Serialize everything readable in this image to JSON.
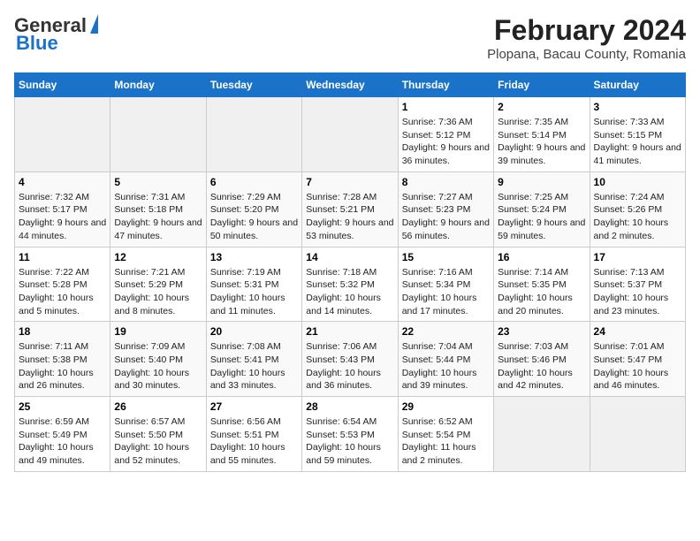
{
  "logo": {
    "line1": "General",
    "line2": "Blue"
  },
  "title": "February 2024",
  "subtitle": "Plopana, Bacau County, Romania",
  "weekdays": [
    "Sunday",
    "Monday",
    "Tuesday",
    "Wednesday",
    "Thursday",
    "Friday",
    "Saturday"
  ],
  "weeks": [
    [
      {
        "day": "",
        "info": ""
      },
      {
        "day": "",
        "info": ""
      },
      {
        "day": "",
        "info": ""
      },
      {
        "day": "",
        "info": ""
      },
      {
        "day": "1",
        "info": "Sunrise: 7:36 AM\nSunset: 5:12 PM\nDaylight: 9 hours and 36 minutes."
      },
      {
        "day": "2",
        "info": "Sunrise: 7:35 AM\nSunset: 5:14 PM\nDaylight: 9 hours and 39 minutes."
      },
      {
        "day": "3",
        "info": "Sunrise: 7:33 AM\nSunset: 5:15 PM\nDaylight: 9 hours and 41 minutes."
      }
    ],
    [
      {
        "day": "4",
        "info": "Sunrise: 7:32 AM\nSunset: 5:17 PM\nDaylight: 9 hours and 44 minutes."
      },
      {
        "day": "5",
        "info": "Sunrise: 7:31 AM\nSunset: 5:18 PM\nDaylight: 9 hours and 47 minutes."
      },
      {
        "day": "6",
        "info": "Sunrise: 7:29 AM\nSunset: 5:20 PM\nDaylight: 9 hours and 50 minutes."
      },
      {
        "day": "7",
        "info": "Sunrise: 7:28 AM\nSunset: 5:21 PM\nDaylight: 9 hours and 53 minutes."
      },
      {
        "day": "8",
        "info": "Sunrise: 7:27 AM\nSunset: 5:23 PM\nDaylight: 9 hours and 56 minutes."
      },
      {
        "day": "9",
        "info": "Sunrise: 7:25 AM\nSunset: 5:24 PM\nDaylight: 9 hours and 59 minutes."
      },
      {
        "day": "10",
        "info": "Sunrise: 7:24 AM\nSunset: 5:26 PM\nDaylight: 10 hours and 2 minutes."
      }
    ],
    [
      {
        "day": "11",
        "info": "Sunrise: 7:22 AM\nSunset: 5:28 PM\nDaylight: 10 hours and 5 minutes."
      },
      {
        "day": "12",
        "info": "Sunrise: 7:21 AM\nSunset: 5:29 PM\nDaylight: 10 hours and 8 minutes."
      },
      {
        "day": "13",
        "info": "Sunrise: 7:19 AM\nSunset: 5:31 PM\nDaylight: 10 hours and 11 minutes."
      },
      {
        "day": "14",
        "info": "Sunrise: 7:18 AM\nSunset: 5:32 PM\nDaylight: 10 hours and 14 minutes."
      },
      {
        "day": "15",
        "info": "Sunrise: 7:16 AM\nSunset: 5:34 PM\nDaylight: 10 hours and 17 minutes."
      },
      {
        "day": "16",
        "info": "Sunrise: 7:14 AM\nSunset: 5:35 PM\nDaylight: 10 hours and 20 minutes."
      },
      {
        "day": "17",
        "info": "Sunrise: 7:13 AM\nSunset: 5:37 PM\nDaylight: 10 hours and 23 minutes."
      }
    ],
    [
      {
        "day": "18",
        "info": "Sunrise: 7:11 AM\nSunset: 5:38 PM\nDaylight: 10 hours and 26 minutes."
      },
      {
        "day": "19",
        "info": "Sunrise: 7:09 AM\nSunset: 5:40 PM\nDaylight: 10 hours and 30 minutes."
      },
      {
        "day": "20",
        "info": "Sunrise: 7:08 AM\nSunset: 5:41 PM\nDaylight: 10 hours and 33 minutes."
      },
      {
        "day": "21",
        "info": "Sunrise: 7:06 AM\nSunset: 5:43 PM\nDaylight: 10 hours and 36 minutes."
      },
      {
        "day": "22",
        "info": "Sunrise: 7:04 AM\nSunset: 5:44 PM\nDaylight: 10 hours and 39 minutes."
      },
      {
        "day": "23",
        "info": "Sunrise: 7:03 AM\nSunset: 5:46 PM\nDaylight: 10 hours and 42 minutes."
      },
      {
        "day": "24",
        "info": "Sunrise: 7:01 AM\nSunset: 5:47 PM\nDaylight: 10 hours and 46 minutes."
      }
    ],
    [
      {
        "day": "25",
        "info": "Sunrise: 6:59 AM\nSunset: 5:49 PM\nDaylight: 10 hours and 49 minutes."
      },
      {
        "day": "26",
        "info": "Sunrise: 6:57 AM\nSunset: 5:50 PM\nDaylight: 10 hours and 52 minutes."
      },
      {
        "day": "27",
        "info": "Sunrise: 6:56 AM\nSunset: 5:51 PM\nDaylight: 10 hours and 55 minutes."
      },
      {
        "day": "28",
        "info": "Sunrise: 6:54 AM\nSunset: 5:53 PM\nDaylight: 10 hours and 59 minutes."
      },
      {
        "day": "29",
        "info": "Sunrise: 6:52 AM\nSunset: 5:54 PM\nDaylight: 11 hours and 2 minutes."
      },
      {
        "day": "",
        "info": ""
      },
      {
        "day": "",
        "info": ""
      }
    ]
  ]
}
